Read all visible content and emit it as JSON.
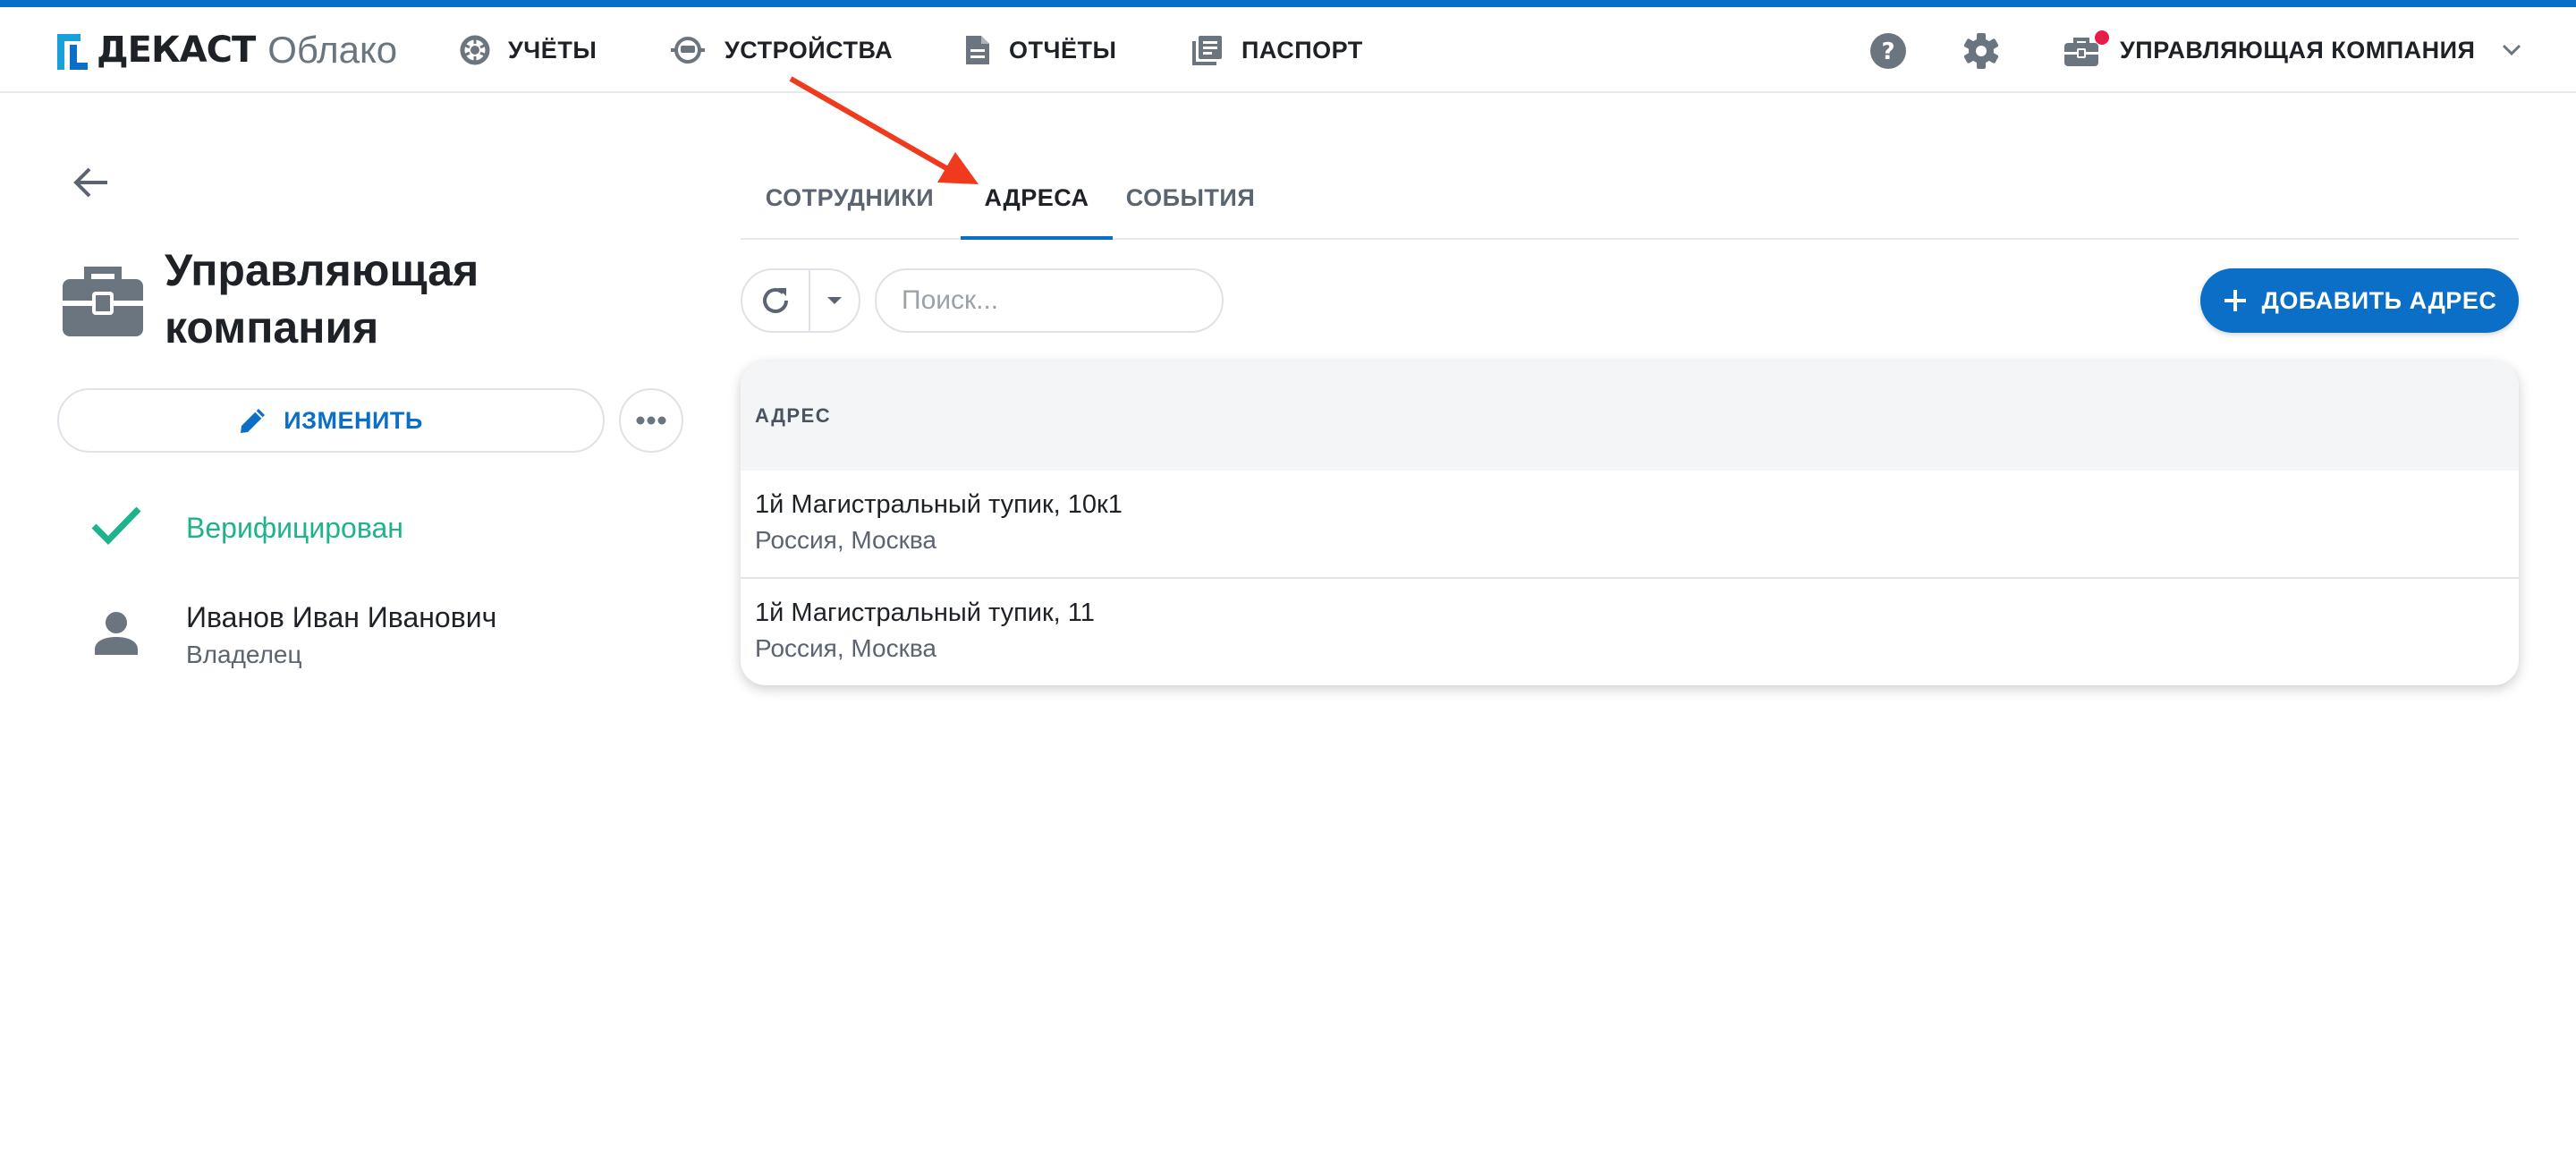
{
  "header": {
    "logo_brand": "ДЕКАСТ",
    "logo_sub": "Облако",
    "nav": [
      {
        "label": "УЧЁТЫ",
        "icon": "meter-icon"
      },
      {
        "label": "УСТРОЙСТВА",
        "icon": "device-icon"
      },
      {
        "label": "ОТЧЁТЫ",
        "icon": "document-icon"
      },
      {
        "label": "ПАСПОРТ",
        "icon": "passport-icon"
      }
    ],
    "company_menu_label": "УПРАВЛЯЮЩАЯ КОМПАНИЯ"
  },
  "sidebar": {
    "title": "Управляющая компания",
    "edit_label": "ИЗМЕНИТЬ",
    "status": "Верифицирован",
    "owner_name": "Иванов Иван Иванович",
    "owner_role": "Владелец"
  },
  "tabs": [
    {
      "label": "СОТРУДНИКИ",
      "active": false
    },
    {
      "label": "АДРЕСА",
      "active": true
    },
    {
      "label": "СОБЫТИЯ",
      "active": false
    }
  ],
  "toolbar": {
    "search_placeholder": "Поиск...",
    "add_label": "ДОБАВИТЬ АДРЕС"
  },
  "table": {
    "column": "АДРЕС",
    "rows": [
      {
        "address": "1й Магистральный тупик, 10к1",
        "region": "Россия, Москва"
      },
      {
        "address": "1й Магистральный тупик, 11",
        "region": "Россия, Москва"
      }
    ]
  },
  "colors": {
    "accent": "#0b6fc7",
    "verified": "#1eb38a",
    "notification": "#e81c48",
    "annotation_arrow": "#f03a1e"
  }
}
